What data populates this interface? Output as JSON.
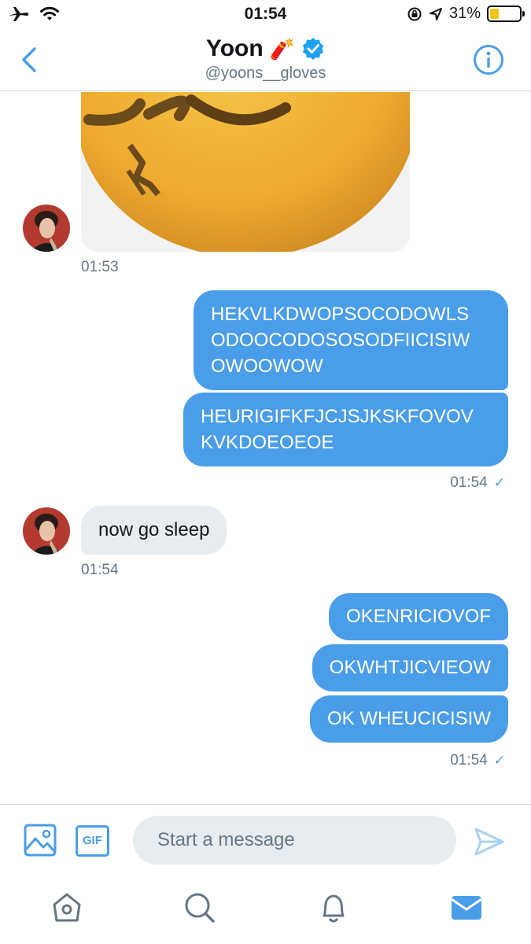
{
  "status_bar": {
    "time": "01:54",
    "battery_pct": "31%",
    "battery_level": 0.31,
    "icons": [
      "airplane-icon",
      "wifi-icon",
      "orientation-lock-icon",
      "location-icon",
      "battery-icon"
    ]
  },
  "header": {
    "name": "Yoon",
    "emoji": "🧨",
    "handle": "@yoons__gloves",
    "verified": true,
    "icons": [
      "back-chevron-icon",
      "info-icon"
    ]
  },
  "messages": [
    {
      "from": "them",
      "type": "image",
      "time": "01:53"
    },
    {
      "from": "me",
      "text": "HEKVLKDWOPSOCODOWLS ODOOCODOSOSODFIICISIW OWOOWOW"
    },
    {
      "from": "me",
      "text": "HEURIGIFKFJCJSJKSKFOVOV KVKDOEOEOE",
      "time": "01:54",
      "read_mark": "✓"
    },
    {
      "from": "them",
      "text": "now go sleep",
      "time": "01:54"
    },
    {
      "from": "me",
      "text": "OKENRICIOVOF"
    },
    {
      "from": "me",
      "text": "OKWHTJICVIEOW"
    },
    {
      "from": "me",
      "text": "OK WHEUCICISIW",
      "time": "01:54",
      "read_mark": "✓"
    }
  ],
  "composer": {
    "placeholder": "Start a message",
    "gif_label": "GIF",
    "icons": [
      "image-icon",
      "gif-icon",
      "send-icon"
    ]
  },
  "tabbar": {
    "items": [
      "home-icon",
      "search-icon",
      "notifications-icon",
      "messages-icon"
    ],
    "active": "messages-icon"
  },
  "colors": {
    "accent": "#4a9de8",
    "incoming_bubble": "#e6ecf0",
    "muted_text": "#657786",
    "battery": "#f5c518"
  }
}
